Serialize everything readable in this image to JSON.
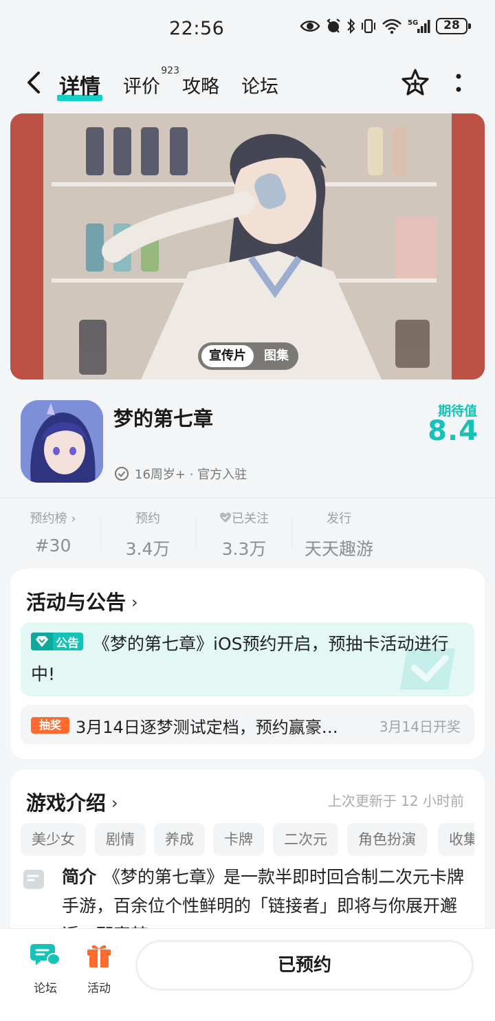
{
  "status_bar": {
    "time": "22:56",
    "battery": "28"
  },
  "nav": {
    "tabs": [
      {
        "label": "详情"
      },
      {
        "label": "评价",
        "badge": "923"
      },
      {
        "label": "攻略"
      },
      {
        "label": "论坛"
      }
    ]
  },
  "banner": {
    "video_tab": "宣传片",
    "gallery_tab": "图集"
  },
  "game": {
    "title": "梦的第七章",
    "meta": "16周岁+ · 官方入驻",
    "expect_label": "期待值",
    "expect_score": "8.4"
  },
  "stats": [
    {
      "label": "预约榜 ›",
      "value": "#30"
    },
    {
      "label": "预约",
      "value": "3.4万"
    },
    {
      "label": "已关注",
      "value": "3.3万"
    },
    {
      "label": "发行",
      "value": "天天趣游"
    }
  ],
  "activities": {
    "title": "活动与公告",
    "notice_tag": "公告",
    "notice_text": "《梦的第七章》iOS预约开启，预抽卡活动进行中!",
    "lottery_tag": "抽奖",
    "lottery_text": "3月14日逐梦测试定档，预约赢豪…",
    "lottery_date": "3月14日开奖"
  },
  "intro": {
    "title": "游戏介绍",
    "updated": "上次更新于 12 小时前",
    "tags": [
      "美少女",
      "剧情",
      "养成",
      "卡牌",
      "二次元",
      "角色扮演",
      "收集"
    ],
    "summary_label": "简介",
    "summary_text": "《梦的第七章》是一款半即时回合制二次元卡牌手游，百余位个性鲜明的「链接者」即将与你展开邂逅，那宿梦..."
  },
  "bottom": {
    "forum_label": "论坛",
    "activity_label": "活动",
    "reserve_label": "已预约"
  },
  "colors": {
    "accent": "#14c2b6",
    "lottery": "#ff6b2c"
  }
}
